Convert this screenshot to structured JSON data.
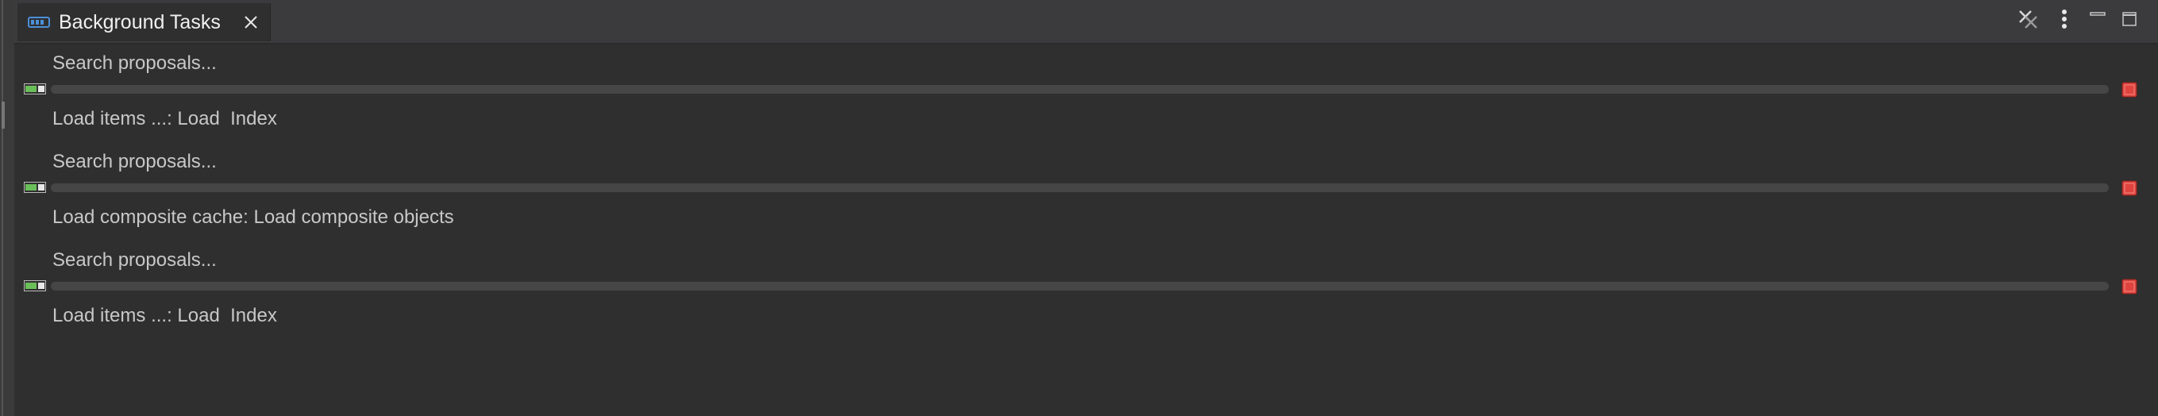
{
  "view": {
    "tab_label": "Background Tasks",
    "tab_icon": "progress-view-icon",
    "close_icon": "close-icon",
    "toolbar": {
      "remove_all_icon": "remove-all-finished-icon",
      "menu_icon": "view-menu-icon",
      "minimize_icon": "minimize-icon",
      "maximize_icon": "maximize-icon"
    }
  },
  "jobs": [
    {
      "title": "Search proposals...",
      "subtask": "Load items ...: Load  Index",
      "progress_fraction": 0.0
    },
    {
      "title": "Search proposals...",
      "subtask": "Load composite cache: Load composite objects",
      "progress_fraction": 0.0
    },
    {
      "title": "Search proposals...",
      "subtask": "Load items ...: Load  Index",
      "progress_fraction": 0.0
    }
  ],
  "colors": {
    "background": "#2f2f2f",
    "tabbar": "#3b3b3d",
    "stop_red": "#e0443e",
    "tab_icon_blue": "#4a90d9",
    "job_icon_green": "#6bbf59"
  }
}
